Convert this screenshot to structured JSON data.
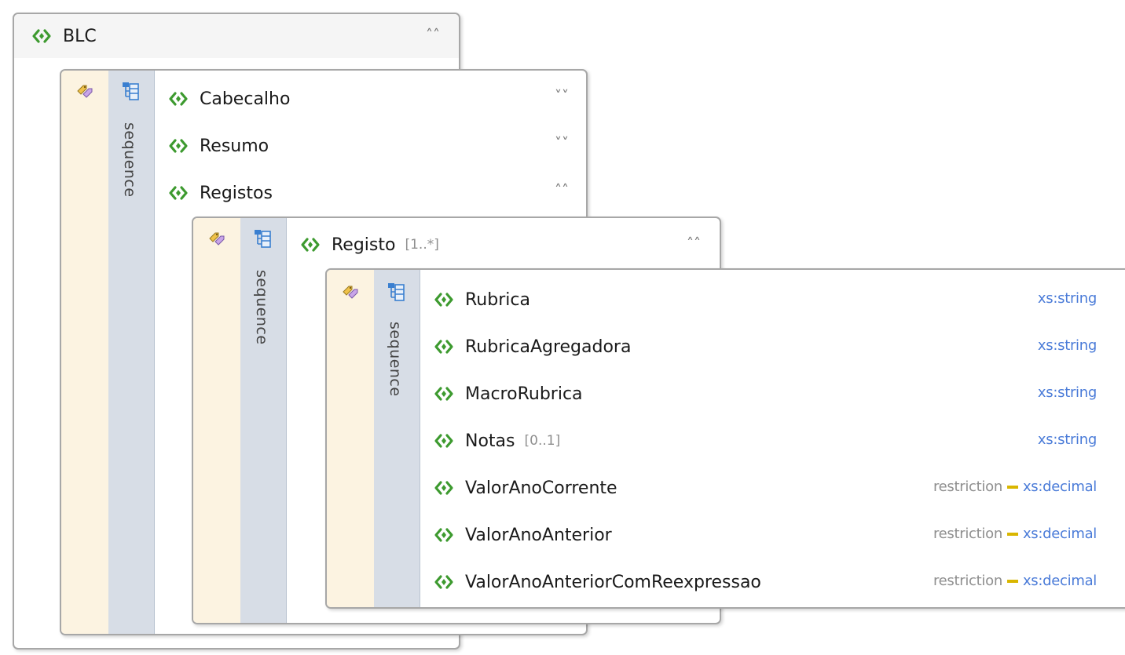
{
  "root": {
    "name": "BLC",
    "chevron": "collapse-up"
  },
  "sequence_label": "sequence",
  "level1": [
    {
      "name": "Cabecalho",
      "chevron": "expand-down"
    },
    {
      "name": "Resumo",
      "chevron": "expand-down"
    },
    {
      "name": "Registos",
      "chevron": "collapse-up"
    }
  ],
  "level2": {
    "name": "Registo",
    "multiplicity": "[1..*]",
    "chevron": "collapse-up"
  },
  "level3": [
    {
      "name": "Rubrica",
      "multiplicity": "",
      "restriction": "",
      "type": "xs:string"
    },
    {
      "name": "RubricaAgregadora",
      "multiplicity": "",
      "restriction": "",
      "type": "xs:string"
    },
    {
      "name": "MacroRubrica",
      "multiplicity": "",
      "restriction": "",
      "type": "xs:string"
    },
    {
      "name": "Notas",
      "multiplicity": "[0..1]",
      "restriction": "",
      "type": "xs:string"
    },
    {
      "name": "ValorAnoCorrente",
      "multiplicity": "",
      "restriction": "restriction",
      "type": "xs:decimal"
    },
    {
      "name": "ValorAnoAnterior",
      "multiplicity": "",
      "restriction": "restriction",
      "type": "xs:decimal"
    },
    {
      "name": "ValorAnoAnteriorComReexpressao",
      "multiplicity": "",
      "restriction": "restriction",
      "type": "xs:decimal"
    }
  ],
  "colors": {
    "element_icon": "#3d9a2f",
    "type_link": "#4a7bd8",
    "sequence_column": "#d7dde6",
    "attribute_column": "#fcf3e1",
    "restriction_bar": "#d9b600"
  }
}
